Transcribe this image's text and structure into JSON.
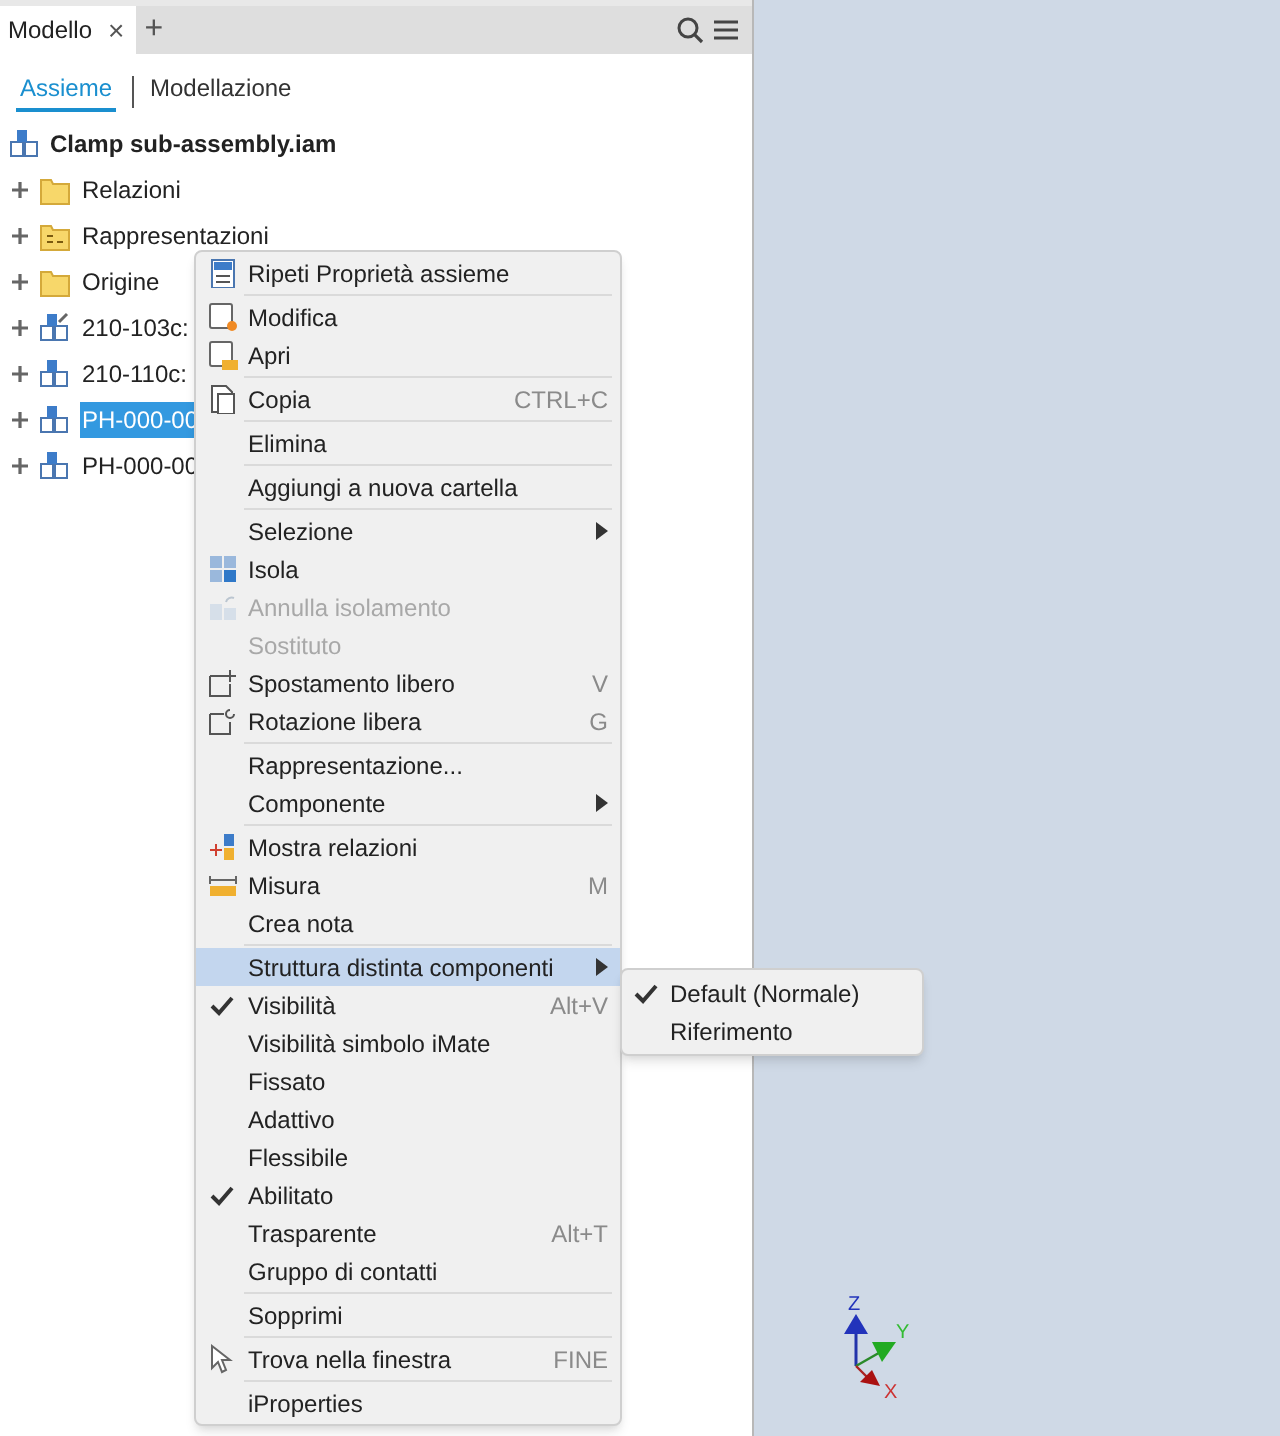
{
  "browser_tab": {
    "title": "Modello",
    "close": "×",
    "add": "+"
  },
  "view_tabs": [
    {
      "label": "Assieme",
      "selected": true
    },
    {
      "label": "Modellazione",
      "selected": false
    }
  ],
  "tree": {
    "label": "Clamp sub-assembly.iam",
    "children": [
      {
        "label": "Relazioni",
        "kind": "folder",
        "selected": false
      },
      {
        "label": "Rappresentazioni",
        "kind": "representations",
        "selected": false
      },
      {
        "label": "Origine",
        "kind": "folder",
        "selected": false
      },
      {
        "label": "210-103c:",
        "kind": "edited-part",
        "selected": false
      },
      {
        "label": "210-110c:",
        "kind": "part",
        "selected": false
      },
      {
        "label": "PH-000-00",
        "kind": "part",
        "selected": true
      },
      {
        "label": "PH-000-00",
        "kind": "part",
        "selected": false
      }
    ]
  },
  "context_menu": [
    {
      "kind": "item",
      "label": "Ripeti Proprietà assieme"
    },
    {
      "kind": "separator"
    },
    {
      "kind": "item",
      "label": "Modifica"
    },
    {
      "kind": "item",
      "label": "Apri"
    },
    {
      "kind": "separator"
    },
    {
      "kind": "item",
      "label": "Copia",
      "shortcut": "CTRL+C"
    },
    {
      "kind": "separator"
    },
    {
      "kind": "item",
      "label": "Elimina"
    },
    {
      "kind": "separator"
    },
    {
      "kind": "item",
      "label": "Aggiungi a nuova cartella"
    },
    {
      "kind": "separator"
    },
    {
      "kind": "item",
      "label": "Selezione",
      "submenu": true
    },
    {
      "kind": "item",
      "label": "Isola"
    },
    {
      "kind": "item",
      "label": "Annulla isolamento",
      "disabled": true
    },
    {
      "kind": "item",
      "label": "Sostituto",
      "disabled": true
    },
    {
      "kind": "item",
      "label": "Spostamento libero",
      "shortcut": "V"
    },
    {
      "kind": "item",
      "label": "Rotazione libera",
      "shortcut": "G"
    },
    {
      "kind": "separator"
    },
    {
      "kind": "item",
      "label": "Rappresentazione..."
    },
    {
      "kind": "item",
      "label": "Componente",
      "submenu": true
    },
    {
      "kind": "separator"
    },
    {
      "kind": "item",
      "label": "Mostra relazioni"
    },
    {
      "kind": "item",
      "label": "Misura",
      "shortcut": "M"
    },
    {
      "kind": "item",
      "label": "Crea nota"
    },
    {
      "kind": "separator"
    },
    {
      "kind": "item",
      "label": "Struttura distinta componenti",
      "submenu": true,
      "selected": true
    },
    {
      "kind": "item",
      "label": "Visibilità",
      "shortcut": "Alt+V",
      "checked": true
    },
    {
      "kind": "item",
      "label": "Visibilità simbolo iMate",
      "checked": false
    },
    {
      "kind": "item",
      "label": "Fissato",
      "checked": false
    },
    {
      "kind": "item",
      "label": "Adattivo",
      "checked": false
    },
    {
      "kind": "item",
      "label": "Flessibile",
      "checked": false
    },
    {
      "kind": "item",
      "label": "Abilitato",
      "checked": true
    },
    {
      "kind": "item",
      "label": "Trasparente",
      "shortcut": "Alt+T",
      "checked": false
    },
    {
      "kind": "item",
      "label": "Gruppo di contatti",
      "checked": false
    },
    {
      "kind": "separator"
    },
    {
      "kind": "item",
      "label": "Sopprimi"
    },
    {
      "kind": "separator"
    },
    {
      "kind": "item",
      "label": "Trova nella finestra",
      "shortcut": "FINE"
    },
    {
      "kind": "separator"
    },
    {
      "kind": "item",
      "label": "iProperties"
    }
  ],
  "submenu": [
    {
      "label": "Default (Normale)",
      "checked": true
    },
    {
      "label": "Riferimento",
      "checked": false
    }
  ],
  "viewcube_axes": {
    "x": "X",
    "y": "Y",
    "z": "Z"
  }
}
